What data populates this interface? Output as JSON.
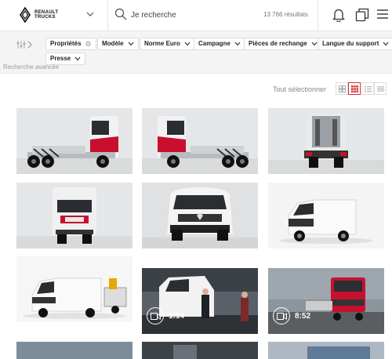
{
  "brand": {
    "logo_text_line1": "RENAULT",
    "logo_text_line2": "TRUCKS"
  },
  "search": {
    "placeholder": "Je recherche",
    "results_count": "13 766 résultats"
  },
  "filters": [
    {
      "label": "Propriétés",
      "icon": "gear-icon"
    },
    {
      "label": "Modèle",
      "icon": "chevron-down-icon"
    },
    {
      "label": "Norme Euro",
      "icon": "chevron-down-icon"
    },
    {
      "label": "Campagne",
      "icon": "chevron-down-icon"
    },
    {
      "label": "Pièces de rechange",
      "icon": "chevron-down-icon"
    },
    {
      "label": "Langue du support",
      "icon": "chevron-down-icon"
    },
    {
      "label": "Presse",
      "icon": "chevron-down-icon"
    }
  ],
  "advanced_search": "Recherche avancée",
  "view": {
    "select_all": "Tout sélectionner",
    "modes": [
      "large-grid-icon",
      "grid-icon",
      "list-icon",
      "compact-list-icon"
    ],
    "active_mode": "grid-icon"
  },
  "colors": {
    "accent": "#d6303a",
    "brand_red": "#c8102e"
  },
  "assets": [
    {
      "type": "image",
      "subject": "truck-side-left"
    },
    {
      "type": "image",
      "subject": "truck-side-left"
    },
    {
      "type": "image",
      "subject": "truck-rear"
    },
    {
      "type": "image",
      "subject": "truck-front"
    },
    {
      "type": "image",
      "subject": "van-front"
    },
    {
      "type": "image",
      "subject": "van-three-quarter"
    },
    {
      "type": "image",
      "subject": "van-with-trailer"
    },
    {
      "type": "video",
      "subject": "van-with-people",
      "duration": "1:14"
    },
    {
      "type": "video",
      "subject": "red-truck-road",
      "duration": "8:52"
    },
    {
      "type": "image",
      "subject": "partial"
    },
    {
      "type": "image",
      "subject": "partial"
    },
    {
      "type": "image",
      "subject": "partial"
    }
  ]
}
